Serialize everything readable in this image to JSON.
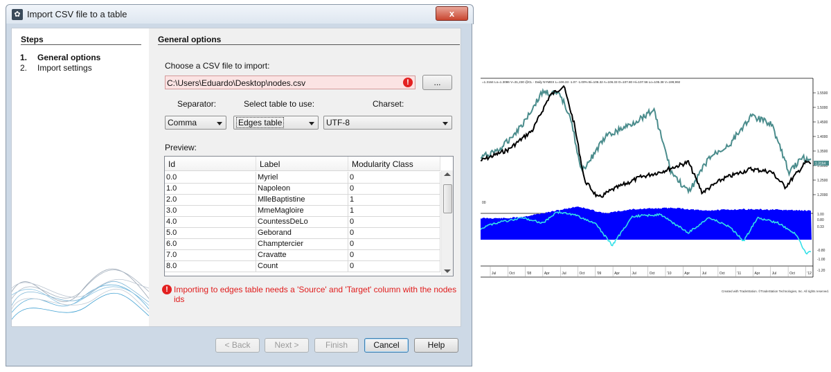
{
  "window": {
    "title": "Import CSV file to a table",
    "close_glyph": "x"
  },
  "steps": {
    "title": "Steps",
    "items": [
      {
        "num": "1.",
        "label": "General options"
      },
      {
        "num": "2.",
        "label": "Import settings"
      }
    ]
  },
  "main": {
    "title": "General options",
    "file_label": "Choose a CSV file to import:",
    "file_path": "C:\\Users\\Eduardo\\Desktop\\nodes.csv",
    "browse_label": "...",
    "separator_label": "Separator:",
    "separator_value": "Comma",
    "table_label": "Select table to use:",
    "table_value": "Edges table",
    "charset_label": "Charset:",
    "charset_value": "UTF-8",
    "preview_label": "Preview:",
    "columns": [
      "Id",
      "Label",
      "Modularity Class"
    ],
    "rows": [
      [
        "0.0",
        "Myriel",
        "0"
      ],
      [
        "1.0",
        "Napoleon",
        "0"
      ],
      [
        "2.0",
        "MlleBaptistine",
        "1"
      ],
      [
        "3.0",
        "MmeMagloire",
        "1"
      ],
      [
        "4.0",
        "CountessDeLo",
        "0"
      ],
      [
        "5.0",
        "Geborand",
        "0"
      ],
      [
        "6.0",
        "Champtercier",
        "0"
      ],
      [
        "7.0",
        "Cravatte",
        "0"
      ],
      [
        "8.0",
        "Count",
        "0"
      ]
    ],
    "error_message": "Importing to edges table needs a 'Source' and 'Target' column with the nodes ids"
  },
  "buttons": {
    "back": "< Back",
    "next": "Next >",
    "finish": "Finish",
    "cancel": "Cancel",
    "help": "Help"
  },
  "chart": {
    "header": "=1.3164 Lo=1.3086 V=31,230 @CL - Daily NYMEX L=106.33 -1.07 -1.00% Bi=106.32 A=106.33 O=107.80 Hi=107.56 Lo=105.38 V=199,992",
    "price_ticks": [
      "1.5500",
      "1.5000",
      "1.4500",
      "1.4000",
      "1.3500",
      "1.3000",
      "1.2500",
      "1.2000"
    ],
    "right_tag": "1.3164",
    "left_tag": "00",
    "osc_ticks": [
      "1.00",
      "0.80",
      "0.33",
      "-0.80",
      "-1.00",
      "-1.20"
    ],
    "x_ticks": [
      "Jul",
      "Oct",
      "'08",
      "Apr",
      "Jul",
      "Oct",
      "'09",
      "Apr",
      "Jul",
      "Oct",
      "'10",
      "Apr",
      "Jul",
      "Oct",
      "'11",
      "Apr",
      "Jul",
      "Oct",
      "'12"
    ],
    "credit": "Created with TradeStation. ©TradeStation Technologies, Inc. All rights reserved.",
    "colors": {
      "series_a": "#000000",
      "series_b": "#4a8c8c",
      "histogram": "#0000ff",
      "oscillator": "#33e0e8"
    }
  }
}
